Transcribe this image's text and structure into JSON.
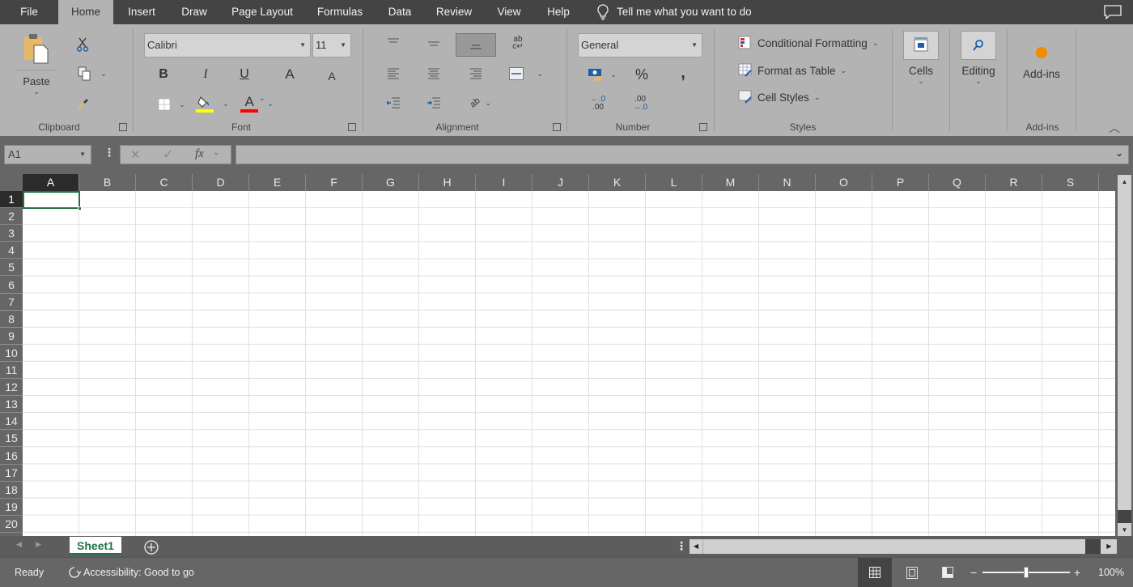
{
  "tabs": [
    {
      "label": "File",
      "active": false
    },
    {
      "label": "Home",
      "active": true
    },
    {
      "label": "Insert",
      "active": false
    },
    {
      "label": "Draw",
      "active": false
    },
    {
      "label": "Page Layout",
      "active": false
    },
    {
      "label": "Formulas",
      "active": false
    },
    {
      "label": "Data",
      "active": false
    },
    {
      "label": "Review",
      "active": false
    },
    {
      "label": "View",
      "active": false
    },
    {
      "label": "Help",
      "active": false
    }
  ],
  "tell_me": {
    "icon": "lightbulb-icon",
    "label": "Tell me what you want to do"
  },
  "ribbon": {
    "clipboard": {
      "label": "Clipboard",
      "paste_label": "Paste"
    },
    "font": {
      "label": "Font",
      "font_name": "Calibri",
      "font_size": "11",
      "bold": "B",
      "italic": "I",
      "underline": "U",
      "grow": "A",
      "shrink": "A",
      "font_color": "A",
      "highlight_color": "#ffff00",
      "font_color_value": "#ff0000"
    },
    "alignment": {
      "label": "Alignment"
    },
    "number": {
      "label": "Number",
      "format": "General",
      "percent": "%",
      "comma": ",",
      "inc_decimal_top": "←.0",
      "inc_decimal_bottom": ".00",
      "dec_decimal_top": ".00",
      "dec_decimal_bottom": "→.0"
    },
    "styles": {
      "label": "Styles",
      "conditional_formatting": "Conditional Formatting",
      "format_as_table": "Format as Table",
      "cell_styles": "Cell Styles"
    },
    "cells": {
      "label": "Cells"
    },
    "editing": {
      "label": "Editing"
    },
    "addins": {
      "button_label": "Add-ins",
      "label": "Add-ins"
    }
  },
  "formula_bar": {
    "name_box": "A1",
    "cancel": "✕",
    "enter": "✓",
    "fx": "fx",
    "value": ""
  },
  "grid": {
    "columns": [
      "A",
      "B",
      "C",
      "D",
      "E",
      "F",
      "G",
      "H",
      "I",
      "J",
      "K",
      "L",
      "M",
      "N",
      "O",
      "P",
      "Q",
      "R",
      "S"
    ],
    "rows": [
      "1",
      "2",
      "3",
      "4",
      "5",
      "6",
      "7",
      "8",
      "9",
      "10",
      "11",
      "12",
      "13",
      "14",
      "15",
      "16",
      "17",
      "18",
      "19",
      "20"
    ],
    "active_cell": "A1"
  },
  "sheets": [
    {
      "label": "Sheet1",
      "active": true
    }
  ],
  "status": {
    "ready": "Ready",
    "accessibility": "Accessibility: Good to go",
    "zoom": "100%",
    "zoom_percent": 100
  },
  "colors": {
    "accent": "#217346",
    "tabbar": "#444444",
    "ribbon": "#b3b3b3"
  }
}
